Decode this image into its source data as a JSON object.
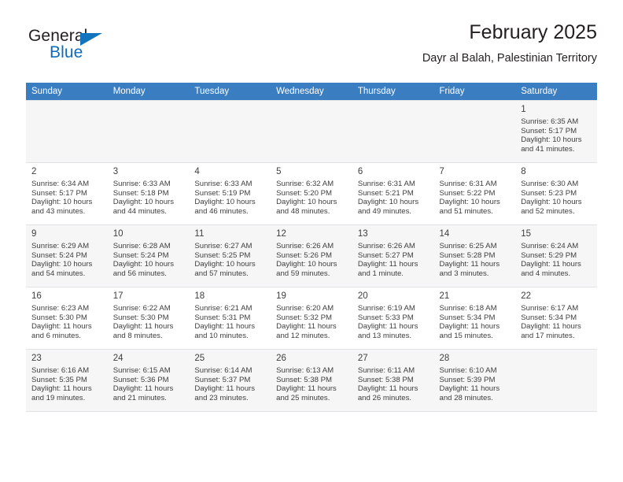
{
  "brand": {
    "name_part1": "General",
    "name_part2": "Blue",
    "flag_icon": "triangle-flag-icon"
  },
  "header": {
    "title": "February 2025",
    "subtitle": "Dayr al Balah, Palestinian Territory"
  },
  "colors": {
    "header_row_bg": "#3b7dc1",
    "header_row_text": "#ffffff",
    "brand_blue": "#0d6cb9",
    "text": "#3e3e3e",
    "shaded_row_bg": "#f6f6f6",
    "grid_line": "#dfe3e6"
  },
  "weekdays": [
    "Sunday",
    "Monday",
    "Tuesday",
    "Wednesday",
    "Thursday",
    "Friday",
    "Saturday"
  ],
  "weeks": [
    {
      "shaded": true,
      "days": [
        {
          "empty": true
        },
        {
          "empty": true
        },
        {
          "empty": true
        },
        {
          "empty": true
        },
        {
          "empty": true
        },
        {
          "empty": true
        },
        {
          "day": "1",
          "sunrise": "Sunrise: 6:35 AM",
          "sunset": "Sunset: 5:17 PM",
          "daylight": "Daylight: 10 hours and 41 minutes."
        }
      ]
    },
    {
      "shaded": false,
      "days": [
        {
          "day": "2",
          "sunrise": "Sunrise: 6:34 AM",
          "sunset": "Sunset: 5:17 PM",
          "daylight": "Daylight: 10 hours and 43 minutes."
        },
        {
          "day": "3",
          "sunrise": "Sunrise: 6:33 AM",
          "sunset": "Sunset: 5:18 PM",
          "daylight": "Daylight: 10 hours and 44 minutes."
        },
        {
          "day": "4",
          "sunrise": "Sunrise: 6:33 AM",
          "sunset": "Sunset: 5:19 PM",
          "daylight": "Daylight: 10 hours and 46 minutes."
        },
        {
          "day": "5",
          "sunrise": "Sunrise: 6:32 AM",
          "sunset": "Sunset: 5:20 PM",
          "daylight": "Daylight: 10 hours and 48 minutes."
        },
        {
          "day": "6",
          "sunrise": "Sunrise: 6:31 AM",
          "sunset": "Sunset: 5:21 PM",
          "daylight": "Daylight: 10 hours and 49 minutes."
        },
        {
          "day": "7",
          "sunrise": "Sunrise: 6:31 AM",
          "sunset": "Sunset: 5:22 PM",
          "daylight": "Daylight: 10 hours and 51 minutes."
        },
        {
          "day": "8",
          "sunrise": "Sunrise: 6:30 AM",
          "sunset": "Sunset: 5:23 PM",
          "daylight": "Daylight: 10 hours and 52 minutes."
        }
      ]
    },
    {
      "shaded": true,
      "days": [
        {
          "day": "9",
          "sunrise": "Sunrise: 6:29 AM",
          "sunset": "Sunset: 5:24 PM",
          "daylight": "Daylight: 10 hours and 54 minutes."
        },
        {
          "day": "10",
          "sunrise": "Sunrise: 6:28 AM",
          "sunset": "Sunset: 5:24 PM",
          "daylight": "Daylight: 10 hours and 56 minutes."
        },
        {
          "day": "11",
          "sunrise": "Sunrise: 6:27 AM",
          "sunset": "Sunset: 5:25 PM",
          "daylight": "Daylight: 10 hours and 57 minutes."
        },
        {
          "day": "12",
          "sunrise": "Sunrise: 6:26 AM",
          "sunset": "Sunset: 5:26 PM",
          "daylight": "Daylight: 10 hours and 59 minutes."
        },
        {
          "day": "13",
          "sunrise": "Sunrise: 6:26 AM",
          "sunset": "Sunset: 5:27 PM",
          "daylight": "Daylight: 11 hours and 1 minute."
        },
        {
          "day": "14",
          "sunrise": "Sunrise: 6:25 AM",
          "sunset": "Sunset: 5:28 PM",
          "daylight": "Daylight: 11 hours and 3 minutes."
        },
        {
          "day": "15",
          "sunrise": "Sunrise: 6:24 AM",
          "sunset": "Sunset: 5:29 PM",
          "daylight": "Daylight: 11 hours and 4 minutes."
        }
      ]
    },
    {
      "shaded": false,
      "days": [
        {
          "day": "16",
          "sunrise": "Sunrise: 6:23 AM",
          "sunset": "Sunset: 5:30 PM",
          "daylight": "Daylight: 11 hours and 6 minutes."
        },
        {
          "day": "17",
          "sunrise": "Sunrise: 6:22 AM",
          "sunset": "Sunset: 5:30 PM",
          "daylight": "Daylight: 11 hours and 8 minutes."
        },
        {
          "day": "18",
          "sunrise": "Sunrise: 6:21 AM",
          "sunset": "Sunset: 5:31 PM",
          "daylight": "Daylight: 11 hours and 10 minutes."
        },
        {
          "day": "19",
          "sunrise": "Sunrise: 6:20 AM",
          "sunset": "Sunset: 5:32 PM",
          "daylight": "Daylight: 11 hours and 12 minutes."
        },
        {
          "day": "20",
          "sunrise": "Sunrise: 6:19 AM",
          "sunset": "Sunset: 5:33 PM",
          "daylight": "Daylight: 11 hours and 13 minutes."
        },
        {
          "day": "21",
          "sunrise": "Sunrise: 6:18 AM",
          "sunset": "Sunset: 5:34 PM",
          "daylight": "Daylight: 11 hours and 15 minutes."
        },
        {
          "day": "22",
          "sunrise": "Sunrise: 6:17 AM",
          "sunset": "Sunset: 5:34 PM",
          "daylight": "Daylight: 11 hours and 17 minutes."
        }
      ]
    },
    {
      "shaded": true,
      "days": [
        {
          "day": "23",
          "sunrise": "Sunrise: 6:16 AM",
          "sunset": "Sunset: 5:35 PM",
          "daylight": "Daylight: 11 hours and 19 minutes."
        },
        {
          "day": "24",
          "sunrise": "Sunrise: 6:15 AM",
          "sunset": "Sunset: 5:36 PM",
          "daylight": "Daylight: 11 hours and 21 minutes."
        },
        {
          "day": "25",
          "sunrise": "Sunrise: 6:14 AM",
          "sunset": "Sunset: 5:37 PM",
          "daylight": "Daylight: 11 hours and 23 minutes."
        },
        {
          "day": "26",
          "sunrise": "Sunrise: 6:13 AM",
          "sunset": "Sunset: 5:38 PM",
          "daylight": "Daylight: 11 hours and 25 minutes."
        },
        {
          "day": "27",
          "sunrise": "Sunrise: 6:11 AM",
          "sunset": "Sunset: 5:38 PM",
          "daylight": "Daylight: 11 hours and 26 minutes."
        },
        {
          "day": "28",
          "sunrise": "Sunrise: 6:10 AM",
          "sunset": "Sunset: 5:39 PM",
          "daylight": "Daylight: 11 hours and 28 minutes."
        },
        {
          "empty": true
        }
      ]
    }
  ]
}
